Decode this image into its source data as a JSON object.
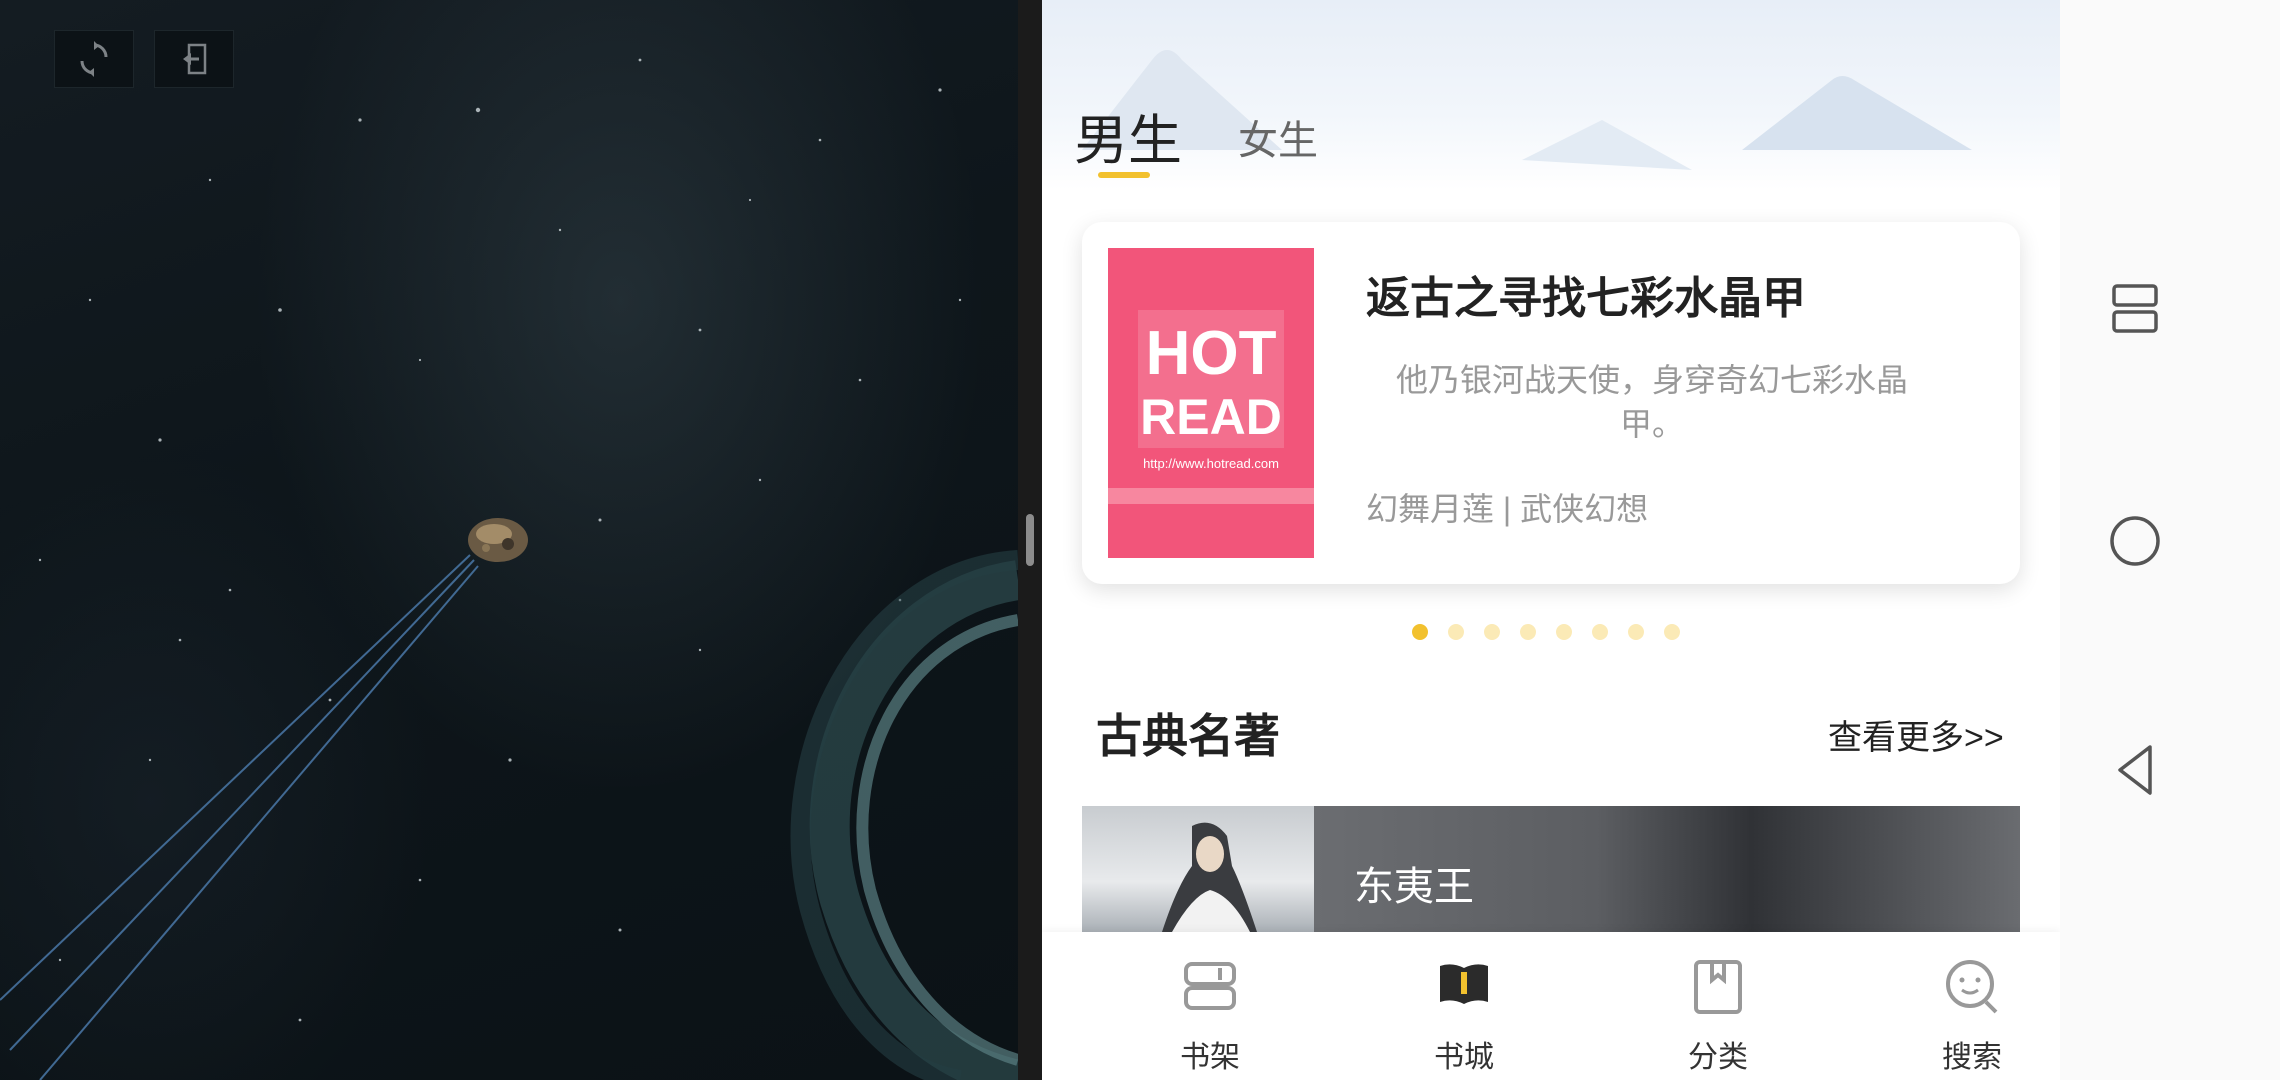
{
  "game": {
    "toolbar": [
      {
        "name": "refresh-icon"
      },
      {
        "name": "exit-icon"
      }
    ]
  },
  "app": {
    "gender_tabs": [
      {
        "label": "男生",
        "active": true
      },
      {
        "label": "女生",
        "active": false
      }
    ],
    "accent_color": "#f2c12e",
    "banner": {
      "cover": {
        "line1": "HOT",
        "line2": "READ",
        "url": "http://www.hotread.com"
      },
      "title": "返古之寻找七彩水晶甲",
      "description": "他乃银河战天使，身穿奇幻七彩水晶甲。",
      "meta": "幻舞月莲 | 武侠幻想",
      "page_count": 8,
      "active_index": 0
    },
    "section": {
      "title": "古典名著",
      "more": "查看更多>>",
      "first_book": "东夷王"
    },
    "bottom_nav": [
      {
        "label": "书架",
        "icon": "bookshelf-icon",
        "active": false
      },
      {
        "label": "书城",
        "icon": "bookstore-icon",
        "active": true
      },
      {
        "label": "分类",
        "icon": "category-icon",
        "active": false
      },
      {
        "label": "搜索",
        "icon": "search-icon",
        "active": false
      }
    ]
  },
  "system_nav": [
    {
      "icon": "recent-apps-icon"
    },
    {
      "icon": "home-icon"
    },
    {
      "icon": "back-icon"
    }
  ]
}
